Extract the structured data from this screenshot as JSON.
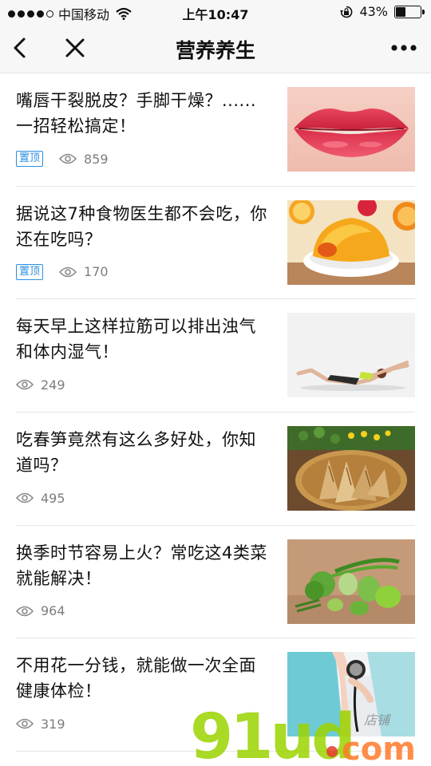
{
  "status_bar": {
    "carrier": "中国移动",
    "time": "上午10:47",
    "battery": "43%",
    "battery_level": 0.43
  },
  "nav": {
    "title": "营养养生",
    "back_icon": "chevron-left-icon",
    "close_icon": "close-icon",
    "more_icon": "more-horizontal-icon"
  },
  "articles": [
    {
      "title": "嘴唇干裂脱皮？手脚干燥？......一招轻松搞定！",
      "pinned": true,
      "pin_label": "置顶",
      "views": "859",
      "thumb": "red-lips"
    },
    {
      "title": "据说这7种食物医生都不会吃，你还在吃吗？",
      "pinned": true,
      "pin_label": "置顶",
      "views": "170",
      "thumb": "orange-jelly-with-fruit"
    },
    {
      "title": "每天早上这样拉筋可以排出浊气和体内湿气！",
      "pinned": false,
      "views": "249",
      "thumb": "woman-stretching"
    },
    {
      "title": "吃春笋竟然有这么多好处，你知道吗？",
      "pinned": false,
      "views": "495",
      "thumb": "bamboo-shoots-basket"
    },
    {
      "title": "换季时节容易上火？常吃这4类菜就能解决！",
      "pinned": false,
      "views": "964",
      "thumb": "green-vegetables"
    },
    {
      "title": "不用花一分钱，就能做一次全面健康体检！",
      "pinned": false,
      "views": "319",
      "thumb": "doctor-stethoscope"
    }
  ],
  "watermark": {
    "brand": "91ud.com",
    "label": "店铺"
  },
  "colors": {
    "pin_blue": "#2a8ee0",
    "watermark_green": "#9bd400",
    "watermark_dot": "#e63b2e"
  }
}
